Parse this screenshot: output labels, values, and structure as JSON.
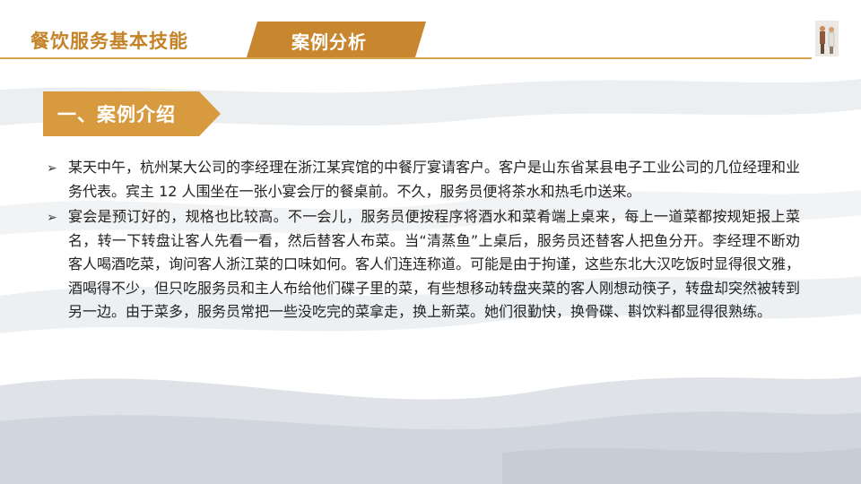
{
  "header": {
    "course_title": "餐饮服务基本技能",
    "tab_label": "案例分析"
  },
  "section": {
    "title": "一、案例介绍"
  },
  "bullets": [
    {
      "marker": "➢",
      "text": "某天中午，杭州某大公司的李经理在浙江某宾馆的中餐厅宴请客户。客户是山东省某县电子工业公司的几位经理和业务代表。宾主 12 人围坐在一张小宴会厅的餐桌前。不久，服务员便将茶水和热毛巾送来。"
    },
    {
      "marker": "➢",
      "text": "宴会是预订好的，规格也比较高。不一会儿，服务员便按程序将酒水和菜肴端上桌来，每上一道菜都按规矩报上菜名，转一下转盘让客人先看一看，然后替客人布菜。当“清蒸鱼”上桌后，服务员还替客人把鱼分开。李经理不断劝客人喝酒吃菜，询问客人浙江菜的口味如何。客人们连连称道。可能是由于拘谨，这些东北大汉吃饭时显得很文雅，酒喝得不少，但只吃服务员和主人布给他们碟子里的菜，有些想移动转盘夹菜的客人刚想动筷子，转盘却突然被转到另一边。由于菜多，服务员常把一些没吃完的菜拿走，换上新菜。她们很勤快，换骨碟、斟饮料都显得很熟练。"
    }
  ],
  "colors": {
    "accent": "#c58328",
    "banner": "#d89a3e",
    "tab": "#c8862f",
    "wave": "#cdd3db"
  }
}
